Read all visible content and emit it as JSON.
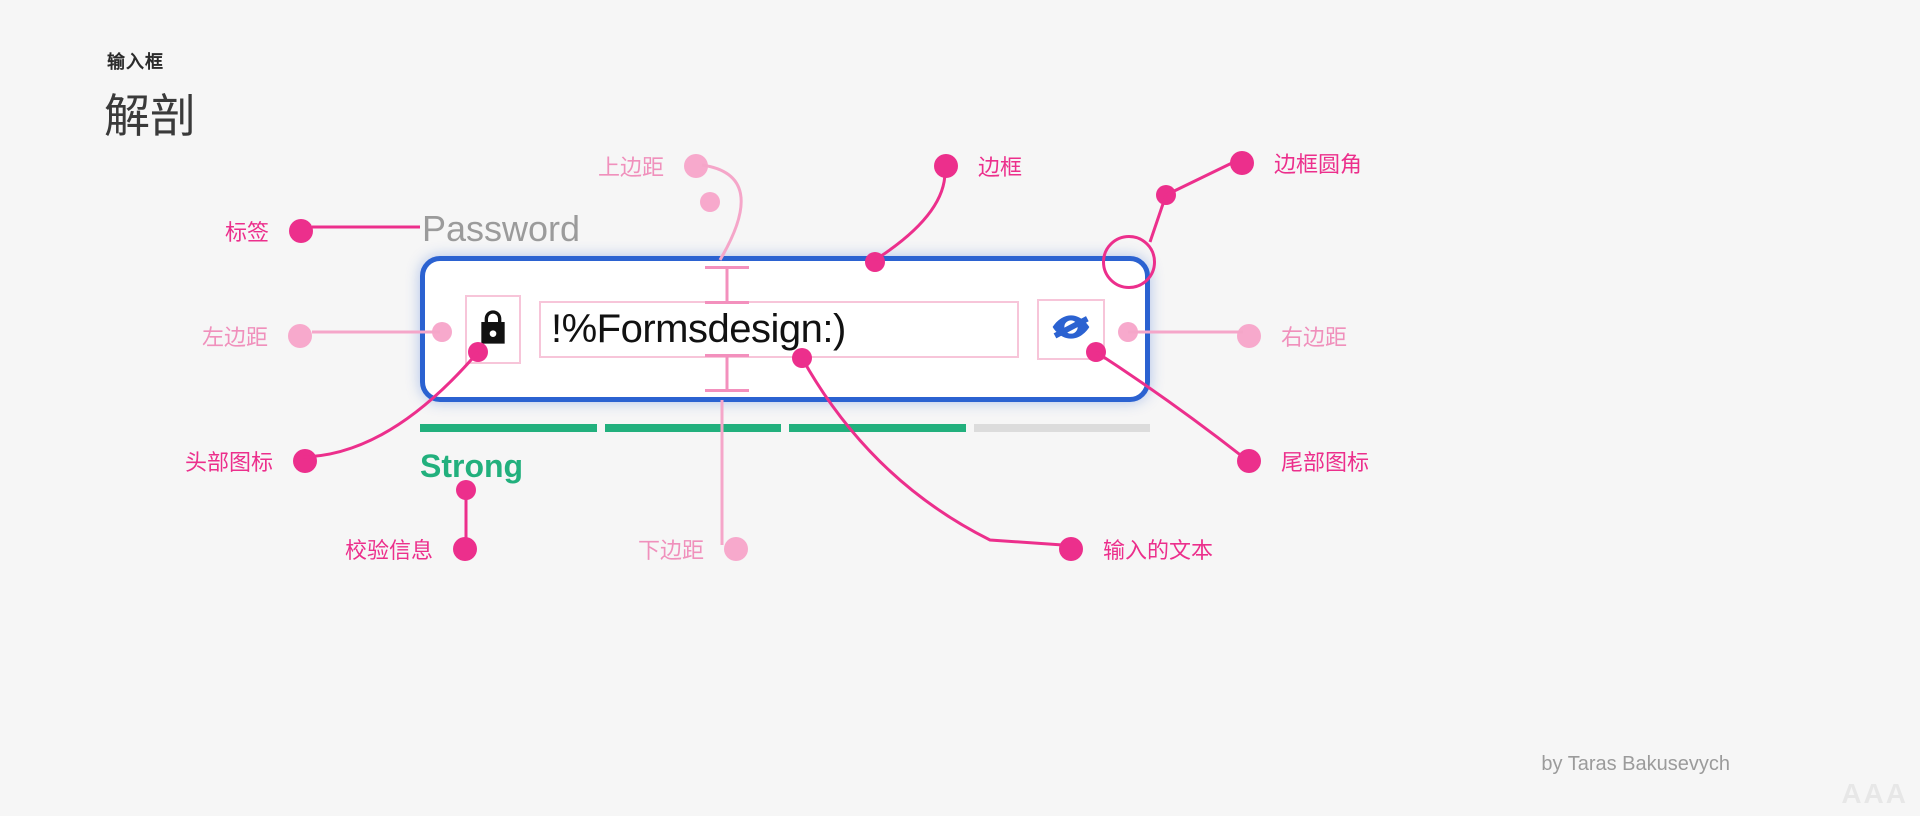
{
  "header": {
    "eyebrow": "输入框",
    "title": "解剖"
  },
  "component": {
    "label": "Password",
    "value": "!%Formsdesign:)",
    "icons": {
      "leading": "lock-icon",
      "trailing": "eye-off-icon"
    },
    "strength": {
      "label": "Strong",
      "filled": 3,
      "total": 4
    },
    "colors": {
      "border": "#2b62d1",
      "strength": "#22b07d",
      "annotation": "#ec2f8c",
      "annotation_dim": "#f090bc"
    }
  },
  "annotations": {
    "label": "标签",
    "left_padding": "左边距",
    "leading_icon": "头部图标",
    "validation": "校验信息",
    "top_padding": "上边距",
    "bottom_padding": "下边距",
    "border": "边框",
    "border_radius": "边框圆角",
    "right_padding": "右边距",
    "trailing_icon": "尾部图标",
    "input_text": "输入的文本"
  },
  "credit": "by Taras Bakusevych",
  "watermark": "AAA"
}
